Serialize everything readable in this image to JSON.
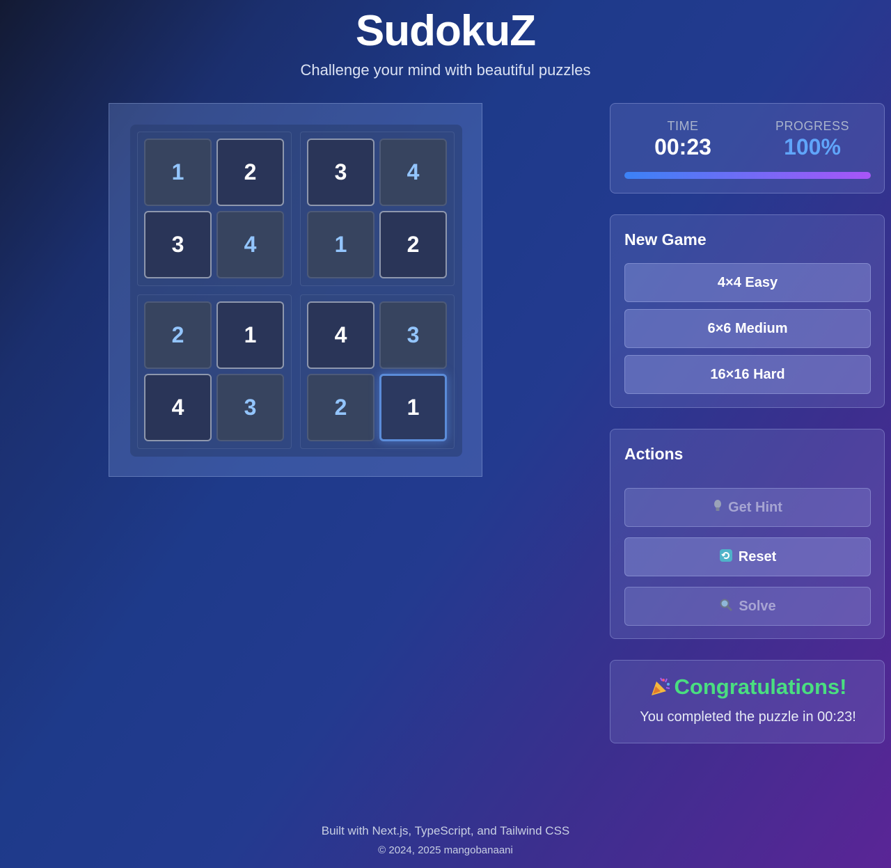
{
  "header": {
    "title": "SudokuZ",
    "subtitle": "Challenge your mind with beautiful puzzles"
  },
  "board": {
    "size": 4,
    "rows": [
      [
        {
          "v": "1",
          "t": "user"
        },
        {
          "v": "2",
          "t": "given"
        },
        {
          "v": "3",
          "t": "given"
        },
        {
          "v": "4",
          "t": "user"
        }
      ],
      [
        {
          "v": "3",
          "t": "given"
        },
        {
          "v": "4",
          "t": "user"
        },
        {
          "v": "1",
          "t": "user"
        },
        {
          "v": "2",
          "t": "given"
        }
      ],
      [
        {
          "v": "2",
          "t": "user"
        },
        {
          "v": "1",
          "t": "given"
        },
        {
          "v": "4",
          "t": "given"
        },
        {
          "v": "3",
          "t": "user"
        }
      ],
      [
        {
          "v": "4",
          "t": "given"
        },
        {
          "v": "3",
          "t": "user"
        },
        {
          "v": "2",
          "t": "user"
        },
        {
          "v": "1",
          "t": "selected"
        }
      ]
    ]
  },
  "stats": {
    "time_label": "TIME",
    "time_value": "00:23",
    "progress_label": "PROGRESS",
    "progress_value": "100%",
    "progress_fraction": 1.0,
    "colors": {
      "time": "#ffffff",
      "progress": "#60a5fa"
    }
  },
  "new_game": {
    "heading": "New Game",
    "options": [
      "4×4 Easy",
      "6×6 Medium",
      "16×16 Hard"
    ]
  },
  "actions": {
    "heading": "Actions",
    "hint": {
      "icon": "lightbulb-icon",
      "label": "Get Hint"
    },
    "reset": {
      "icon": "reset-icon",
      "label": "Reset"
    },
    "solve": {
      "icon": "magnifier-icon",
      "label": "Solve"
    }
  },
  "congrats": {
    "icon": "party-popper-icon",
    "title": "Congratulations!",
    "message": "You completed the puzzle in 00:23!"
  },
  "footer": {
    "line1": "Built with Next.js, TypeScript, and Tailwind CSS",
    "line2": "© 2024, 2025 mangobanaani"
  }
}
